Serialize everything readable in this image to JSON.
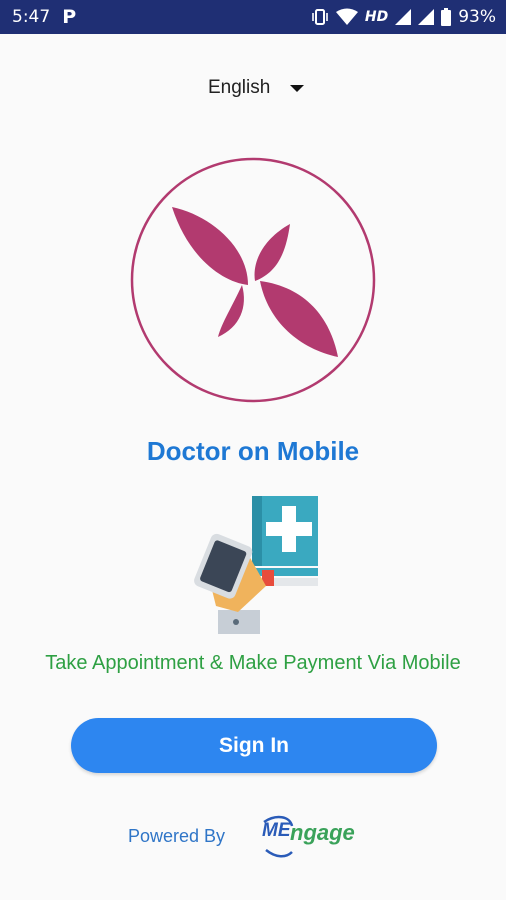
{
  "status_bar": {
    "time": "5:47",
    "notification_glyph": "P",
    "network_label": "HD",
    "battery_percent": "93%"
  },
  "language_selector": {
    "selected": "English"
  },
  "app": {
    "title": "Doctor on Mobile",
    "tagline": "Take Appointment & Make Payment Via Mobile"
  },
  "sign_in": {
    "label": "Sign In"
  },
  "footer": {
    "powered_by": "Powered By",
    "brand_prefix": "ME",
    "brand_suffix": "ngage"
  },
  "colors": {
    "status_bar": "#1f2f74",
    "title": "#1e78d4",
    "tagline": "#2ea043",
    "button": "#2d86f0",
    "logo": "#b23a6f"
  }
}
